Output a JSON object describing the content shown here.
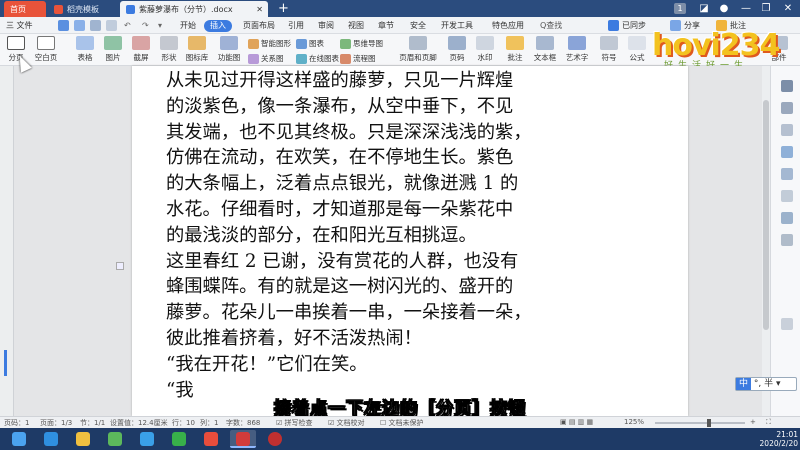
{
  "tabs": [
    {
      "label": "首页"
    },
    {
      "label": "稻壳模板"
    },
    {
      "label": "紫藤萝瀑布（分节）.docx"
    }
  ],
  "window": {
    "badge": "1"
  },
  "menu": {
    "file": "三 文件",
    "items": [
      "开始",
      "插入",
      "页面布局",
      "引用",
      "审阅",
      "视图",
      "章节",
      "安全",
      "开发工具",
      "特色应用"
    ],
    "search": "Q查找",
    "sync": "已同步",
    "share": "分享",
    "comment": "批注"
  },
  "ribbon": {
    "big_left": [
      "分页",
      "空白页"
    ],
    "buttons": [
      "表格",
      "图片",
      "截屏",
      "形状",
      "图标库",
      "功能图",
      "智能图形",
      "图表",
      "思维导图",
      "关系图",
      "在线图表",
      "流程图",
      "页眉和页脚",
      "页码",
      "水印",
      "批注",
      "文本框",
      "艺术字",
      "符号",
      "公式",
      "部件"
    ]
  },
  "logo": {
    "text": "hovi234",
    "sub": "好生活好一生"
  },
  "document": {
    "lines": [
      "从未见过开得这样盛的藤萝，只见一片辉煌",
      "的淡紫色，像一条瀑布，从空中垂下，不见",
      "其发端，也不见其终极。只是深深浅浅的紫，",
      "仿佛在流动，在欢笑，在不停地生长。紫色",
      "的大条幅上，泛着点点银光，就像迸溅 1 的",
      "水花。仔细看时，才知道那是每一朵紫花中",
      "的最浅淡的部分，在和阳光互相挑逗。",
      "这里春红 2 已谢，没有赏花的人群，也没有",
      "蜂围蝶阵。有的就是这一树闪光的、盛开的",
      "藤萝。花朵儿一串挨着一串，一朵接着一朵，",
      "彼此推着挤着，好不活泼热闹！",
      "“我在开花！”它们在笑。",
      "“我"
    ]
  },
  "ime": {
    "mode": "中",
    "punct": "°,",
    "width": "半"
  },
  "subtitle": "接着点一下左边的［分页］按钮",
  "status": {
    "page": "页码：1",
    "pages": "页面：1/3",
    "section": "节：1/1",
    "setting": "设置值：12.4厘米",
    "row": "行：10",
    "col": "列：1",
    "words": "字数：868",
    "spell": "拼写检查",
    "proof": "文档校对",
    "protect": "文档未保护",
    "zoom": "125%"
  },
  "taskbar": {
    "time": "21:01",
    "date": "2020/2/20"
  },
  "colors": {
    "tabbar": "#2b4c7e",
    "accent": "#3c7be0",
    "home_tab": "#e8533a",
    "taskbar": "#1e3a66"
  }
}
